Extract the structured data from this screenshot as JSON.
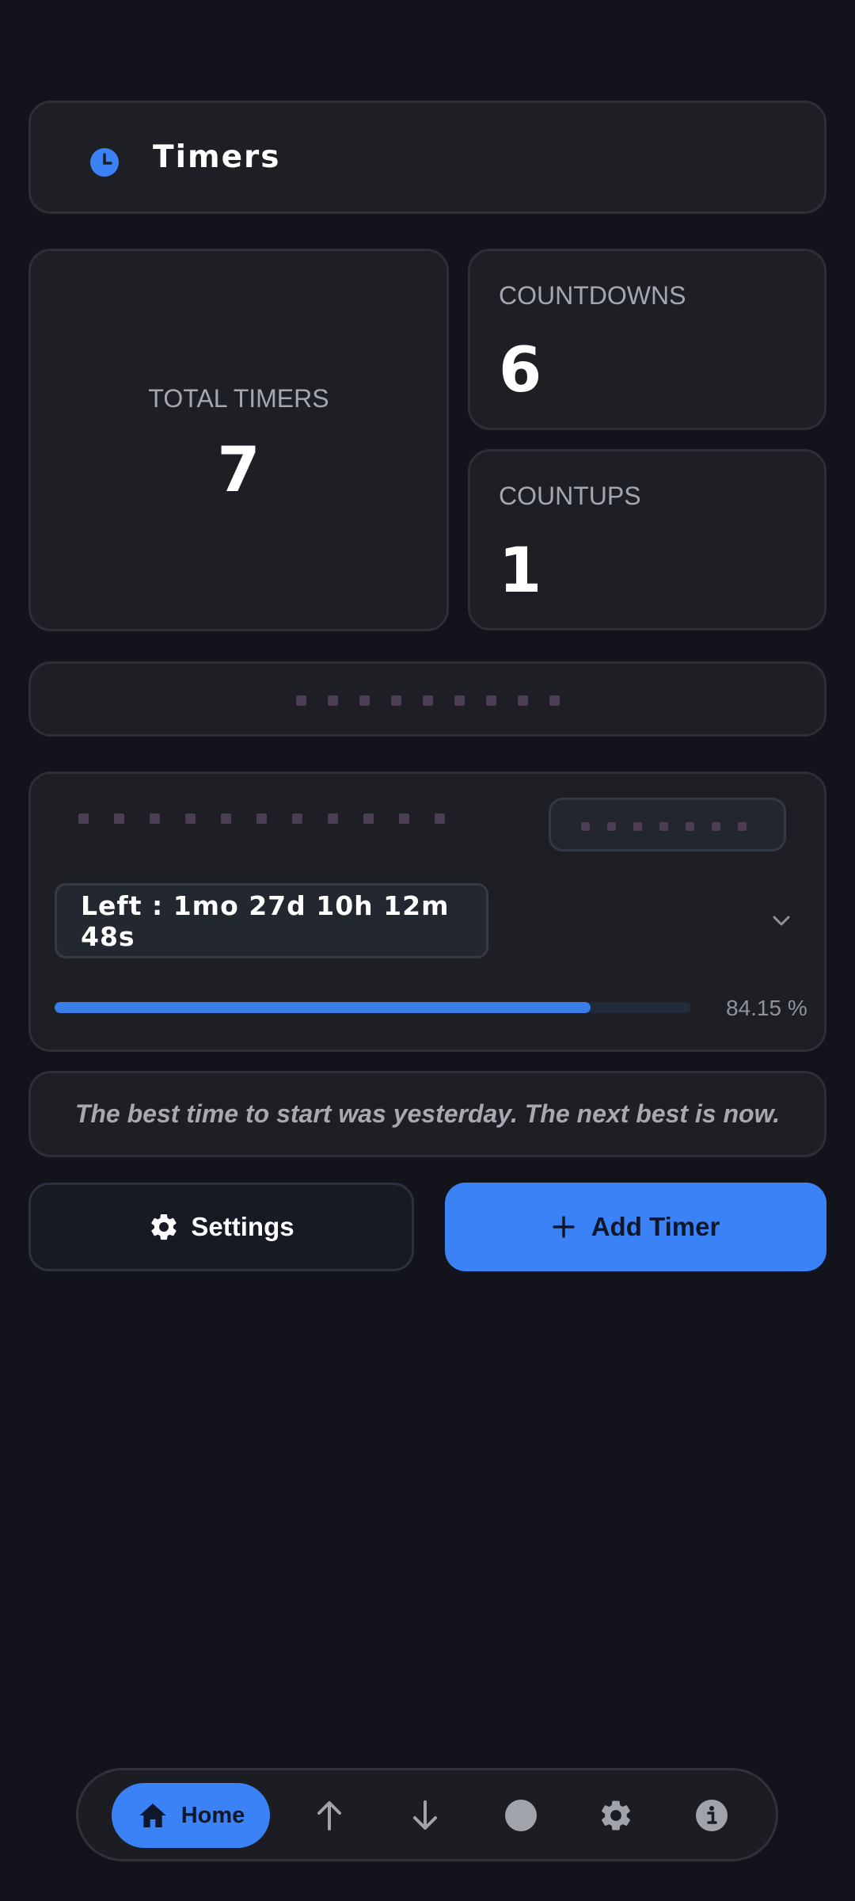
{
  "header": {
    "title": "Timers",
    "icon": "clock-icon",
    "accent": "#3b82f6"
  },
  "stats": {
    "total": {
      "label": "TOTAL TIMERS",
      "value": "7"
    },
    "countdowns": {
      "label": "COUNTDOWNS",
      "value": "6"
    },
    "countups": {
      "label": "COUNTUPS",
      "value": "1"
    }
  },
  "timer": {
    "left_text": "Left : 1mo 27d 10h 12m 48s",
    "progress_fraction": 0.8415,
    "progress_text": "84.15 %",
    "progress_color": "#3b7de8"
  },
  "quote": "The best time to start was yesterday. The next best is now.",
  "actions": {
    "settings_label": "Settings",
    "add_label": "Add Timer",
    "add_color": "#3b82f6"
  },
  "nav": {
    "items": [
      {
        "label": "Home",
        "icon": "home-icon",
        "active": true
      },
      {
        "icon": "arrow-up-icon"
      },
      {
        "icon": "arrow-down-icon"
      },
      {
        "icon": "circle-icon"
      },
      {
        "icon": "gear-icon"
      },
      {
        "icon": "info-icon"
      }
    ]
  }
}
